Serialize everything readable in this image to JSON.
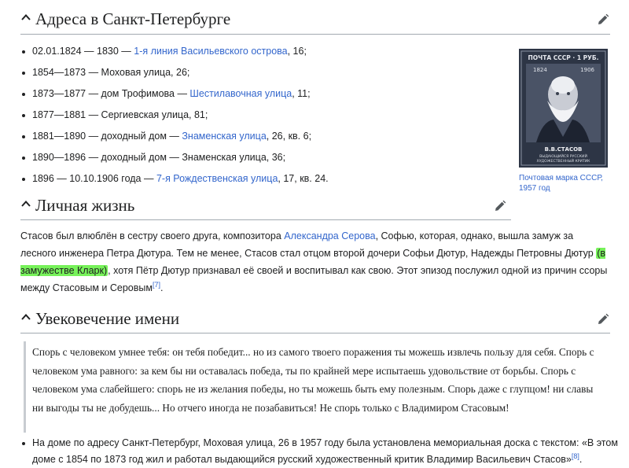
{
  "sections": {
    "addresses": {
      "title": "Адреса в Санкт-Петербурге"
    },
    "personal": {
      "title": "Личная жизнь"
    },
    "memory": {
      "title": "Увековечение имени"
    }
  },
  "addresses": [
    {
      "a": "02.01.1824 — 1830 — ",
      "link": "1-я линия Васильевского острова",
      "b": ", 16;"
    },
    {
      "a": "1854—1873 — Моховая улица, 26;",
      "link": "",
      "b": ""
    },
    {
      "a": "1873—1877 — дом Трофимова — ",
      "link": "Шестилавочная улица",
      "b": ", 11;"
    },
    {
      "a": "1877—1881 — Сергиевская улица, 81;",
      "link": "",
      "b": ""
    },
    {
      "a": "1881—1890 — доходный дом — ",
      "link": "Знаменская улица",
      "b": ", 26, кв. 6;"
    },
    {
      "a": "1890—1896 — доходный дом — Знаменская улица, 36;",
      "link": "",
      "b": ""
    },
    {
      "a": "1896 — 10.10.1906 года — ",
      "link": "7-я Рождественская улица",
      "b": ", 17, кв. 24."
    }
  ],
  "stamp": {
    "top_text": "ПОЧТА СССР · 1 РУБ.",
    "year_left": "1824",
    "year_right": "1906",
    "name": "В.В.СТАСОВ",
    "subtitle_1": "ВЫДАЮЩИЙСЯ РУССКИЙ",
    "subtitle_2": "ХУДОЖЕСТВЕННЫЙ КРИТИК",
    "caption": "Почтовая марка СССР, 1957 год"
  },
  "personal": {
    "p1": "Стасов был влюблён в сестру своего друга, композитора ",
    "link1": "Александра Серова",
    "p2": ", Софью, которая, однако, вышла замуж за лесного инженера Петра Дютура. Тем не менее, Стасов стал отцом второй дочери Софьи Дютур, Надежды Петровны Дютур ",
    "highlight": "(в замужестве Кларк)",
    "p3": ", хотя Пётр Дютур признавал её своей и воспитывал как свою. Этот эпизод послужил одной из причин ссоры между Стасовым и Серовым",
    "ref": "[7]",
    "p4": "."
  },
  "quote": "Спорь с человеком умнее тебя: он тебя победит... но из самого твоего поражения ты можешь извлечь пользу для себя. Спорь с человеком ума равного: за кем бы ни оставалась победа, ты по крайней мере испытаешь удовольствие от борьбы. Спорь с человеком ума слабейшего: спорь не из желания победы, но ты можешь быть ему полезным. Спорь даже с глупцом! ни славы ни выгоды ты не добудешь... Но отчего иногда не позабавиться! Не спорь только с Владимиром Стасовым!",
  "memorial": {
    "text": "На доме по адресу Санкт-Петербург, Моховая улица, 26 в 1957 году была установлена мемориальная доска с текстом: «В этом доме с 1854 по 1873 год жил и работал выдающийся русский художественный критик Владимир Васильевич Стасов»",
    "ref": "[8]",
    "end": "."
  }
}
